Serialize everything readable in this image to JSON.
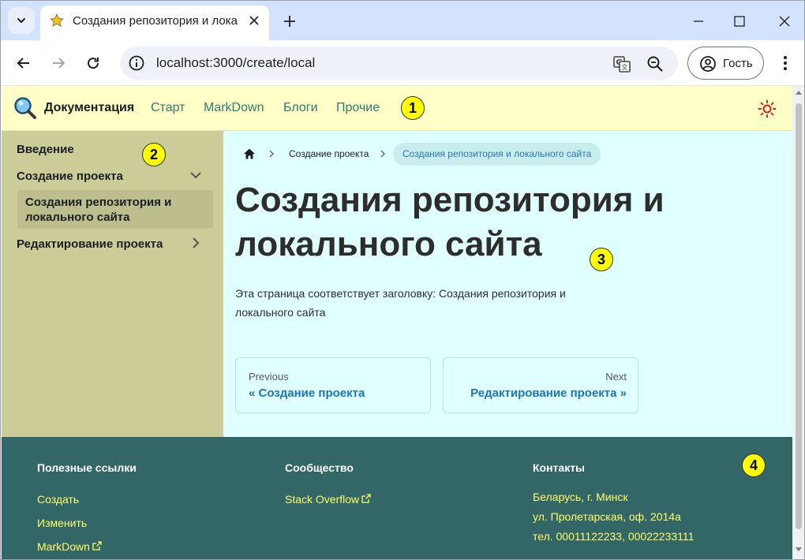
{
  "browser": {
    "tab_title": "Создания репозитория и лока",
    "url": "localhost:3000/create/local",
    "guest_label": "Гость"
  },
  "site": {
    "brand": "Документация",
    "nav_links": [
      "Старт",
      "MarkDown",
      "Блоги",
      "Прочие"
    ]
  },
  "sidebar": {
    "items": [
      {
        "label": "Введение"
      },
      {
        "label": "Создание проекта",
        "expanded": true
      },
      {
        "label": "Создания репозитория и локального сайта",
        "active": true
      },
      {
        "label": "Редактирование проекта",
        "expanded": false
      }
    ]
  },
  "breadcrumb": {
    "items": [
      "Создание проекта",
      "Создания репозитория и локального сайта"
    ]
  },
  "page": {
    "title": "Создания репозитория и локального сайта",
    "text": "Эта страница соответствует заголовку: Создания репозитория и локального сайта"
  },
  "pager": {
    "prev_sub": "Previous",
    "prev_label": "« Создание проекта",
    "next_sub": "Next",
    "next_label": "Редактирование проекта »"
  },
  "footer": {
    "useful_title": "Полезные ссылки",
    "useful_links": [
      "Создать",
      "Изменить",
      "MarkDown"
    ],
    "community_title": "Сообщество",
    "community_links": [
      "Stack Overflow"
    ],
    "contacts_title": "Контакты",
    "contacts": [
      "Беларусь, г. Минск",
      "ул. Пролетарская, оф. 2014а",
      "тел. 00011122233, 00022233111"
    ]
  },
  "callouts": [
    "1",
    "2",
    "3",
    "4"
  ],
  "colors": {
    "navbar_bg": "#ffffc8",
    "sidebar_bg": "#cccc99",
    "main_bg": "#e0ffff",
    "footer_bg": "#336666",
    "footer_link": "#ffff66",
    "link_blue": "#1b75bc",
    "callout": "#ffff00"
  }
}
